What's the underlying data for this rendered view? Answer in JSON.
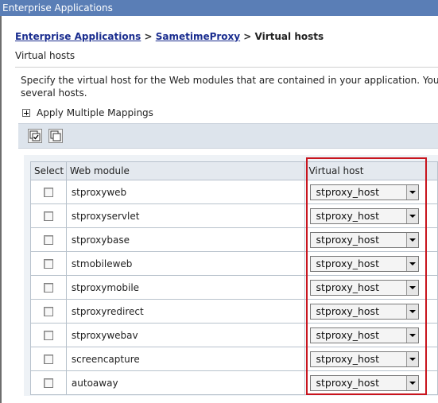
{
  "window": {
    "title": "Enterprise Applications"
  },
  "breadcrumb": {
    "link1": "Enterprise Applications",
    "sep1": " > ",
    "link2": "SametimeProxy",
    "sep2": " > ",
    "current": "Virtual hosts"
  },
  "page": {
    "subtitle": "Virtual hosts",
    "description_line1": "Specify the virtual host for the Web modules that are contained in your application. You can instal",
    "description_line2": "several hosts."
  },
  "mapping": {
    "label": "Apply Multiple Mappings"
  },
  "toolbar": {
    "buttons": [
      "select-all-icon",
      "deselect-all-icon"
    ]
  },
  "table": {
    "headers": {
      "select": "Select",
      "module": "Web module",
      "vhost": "Virtual host"
    },
    "rows": [
      {
        "module": "stproxyweb",
        "vhost": "stproxy_host"
      },
      {
        "module": "stproxyservlet",
        "vhost": "stproxy_host"
      },
      {
        "module": "stproxybase",
        "vhost": "stproxy_host"
      },
      {
        "module": "stmobileweb",
        "vhost": "stproxy_host"
      },
      {
        "module": "stproxymobile",
        "vhost": "stproxy_host"
      },
      {
        "module": "stproxyredirect",
        "vhost": "stproxy_host"
      },
      {
        "module": "stproxywebav",
        "vhost": "stproxy_host"
      },
      {
        "module": "screencapture",
        "vhost": "stproxy_host"
      },
      {
        "module": "autoaway",
        "vhost": "stproxy_host"
      }
    ]
  },
  "colors": {
    "titlebar": "#5a7eb6",
    "link": "#1a2d8f",
    "highlight": "#c8141d"
  }
}
